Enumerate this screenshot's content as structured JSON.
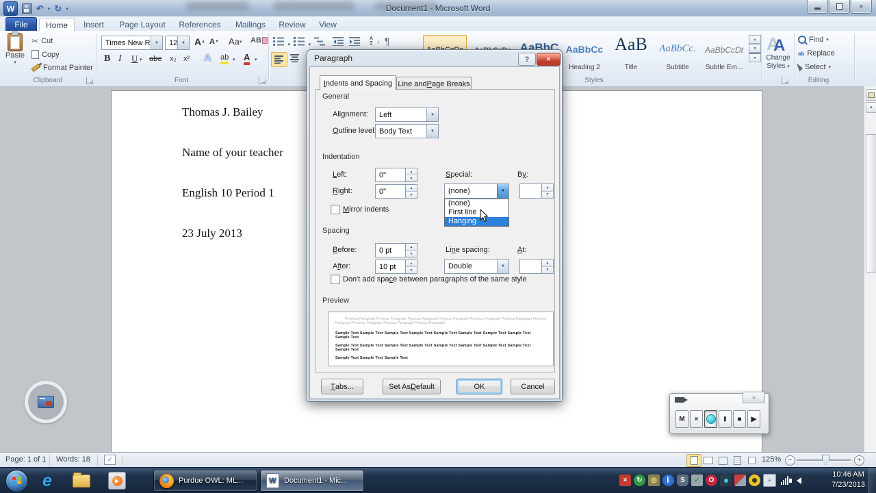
{
  "titlebar": {
    "title": "Document1  -  Microsoft Word"
  },
  "ribbon": {
    "file_tab": "File",
    "tabs": [
      "Home",
      "Insert",
      "Page Layout",
      "References",
      "Mailings",
      "Review",
      "View"
    ],
    "clipboard": {
      "group": "Clipboard",
      "paste": "Paste",
      "cut": "Cut",
      "copy": "Copy",
      "format_painter": "Format Painter"
    },
    "font": {
      "group": "Font",
      "family": "Times New Rom",
      "size": "12"
    },
    "styles": {
      "group": "Styles",
      "previews": [
        "AaBbCcDc",
        "AaBbCcDc",
        "AaBbC",
        "AaBbCc",
        "AaB",
        "AaBbCc.",
        "AaBbCcDt"
      ],
      "labels": [
        "Heading 2",
        "Title",
        "Subtitle",
        "Subtle Em..."
      ]
    },
    "change_styles": {
      "line1": "Change",
      "line2": "Styles"
    },
    "editing": {
      "group": "Editing",
      "find": "Find",
      "replace": "Replace",
      "select": "Select"
    }
  },
  "document": {
    "lines": [
      "Thomas J. Bailey",
      "Name of your teacher",
      "English 10 Period 1",
      "23 July 2013"
    ]
  },
  "dialog": {
    "title": "Paragraph",
    "tab1": "Indents and Spacing",
    "tab2": "Line and Page Breaks",
    "general": {
      "header": "General",
      "alignment_label": "Alignment:",
      "alignment_value": "Left",
      "outline_label": "Outline level:",
      "outline_value": "Body Text"
    },
    "indent": {
      "header": "Indentation",
      "left_label": "Left:",
      "left_value": "0\"",
      "right_label": "Right:",
      "right_value": "0\"",
      "special_label": "Special:",
      "special_value": "(none)",
      "by_label": "By:",
      "by_value": "",
      "mirror_label": "Mirror indents",
      "dropdown": [
        "(none)",
        "First line",
        "Hanging"
      ]
    },
    "spacing": {
      "header": "Spacing",
      "before_label": "Before:",
      "before_value": "0 pt",
      "after_label": "After:",
      "after_value": "10 pt",
      "line_label": "Line spacing:",
      "line_value": "Double",
      "at_label": "At:",
      "at_value": "",
      "checkbox_label": "Don't add space between paragraphs of the same style"
    },
    "preview": {
      "header": "Preview",
      "prev_text": "Previous Paragraph Previous Paragraph Previous Paragraph Previous Paragraph Previous Paragraph Previous Paragraph Previous Paragraph Previous Paragraph Previous Paragraph Previous Paragraph",
      "sample1": "Sample Text Sample Text Sample Text Sample Text Sample Text Sample Text Sample Text Sample Text Sample Text",
      "sample2": "Sample Text Sample Text Sample Text Sample Text Sample Text Sample Text Sample Text Sample Text Sample Text",
      "sample3": "Sample Text Sample Text Sample Text"
    },
    "buttons": {
      "tabs": "Tabs...",
      "set_default": "Set As Default",
      "ok": "OK",
      "cancel": "Cancel"
    }
  },
  "statusbar": {
    "page": "Page: 1 of 1",
    "words": "Words: 18",
    "zoom_level": "125%"
  },
  "taskbar": {
    "task1": "Purdue OWL: ML...",
    "task2": "Document1 - Mic...",
    "time": "10:46 AM",
    "date": "7/23/2013"
  },
  "recorder": {
    "m": "M",
    "x": "×",
    "pause": "Ⅱ",
    "stop": "■",
    "play": "▶"
  },
  "icons": {
    "undo": "↶",
    "redo": "↻",
    "dropdown": "▾",
    "combo_arrow": "▼",
    "spin_up": "▲",
    "spin_down": "▼",
    "cut": "✂",
    "bold": "B",
    "italic": "I",
    "underline": "U",
    "strike": "abe",
    "subscript": "x₂",
    "superscript": "x²",
    "effects": "A",
    "highlight_ab": "ab",
    "font_color_a": "A",
    "grow": "A",
    "shrink": "A",
    "case": "Aa",
    "clear": "AB",
    "pilcrow": "¶",
    "sort_a": "A",
    "sort_z": "Z",
    "sort_arrow": "↓",
    "close": "×",
    "help": "?",
    "proof_check": "✓",
    "scroll_up": "▲",
    "scroll_down": "▼",
    "zoom_minus": "−",
    "zoom_plus": "+",
    "bluetooth": "ᛒ",
    "steam": "S",
    "opera": "O",
    "ie": "e"
  },
  "colors": {
    "selection_blue": "#2f80d8",
    "dialog_close_red": "#c44531",
    "ribbon_highlight": "#fde7a7",
    "taskbar_bg": "#1b2c42"
  }
}
